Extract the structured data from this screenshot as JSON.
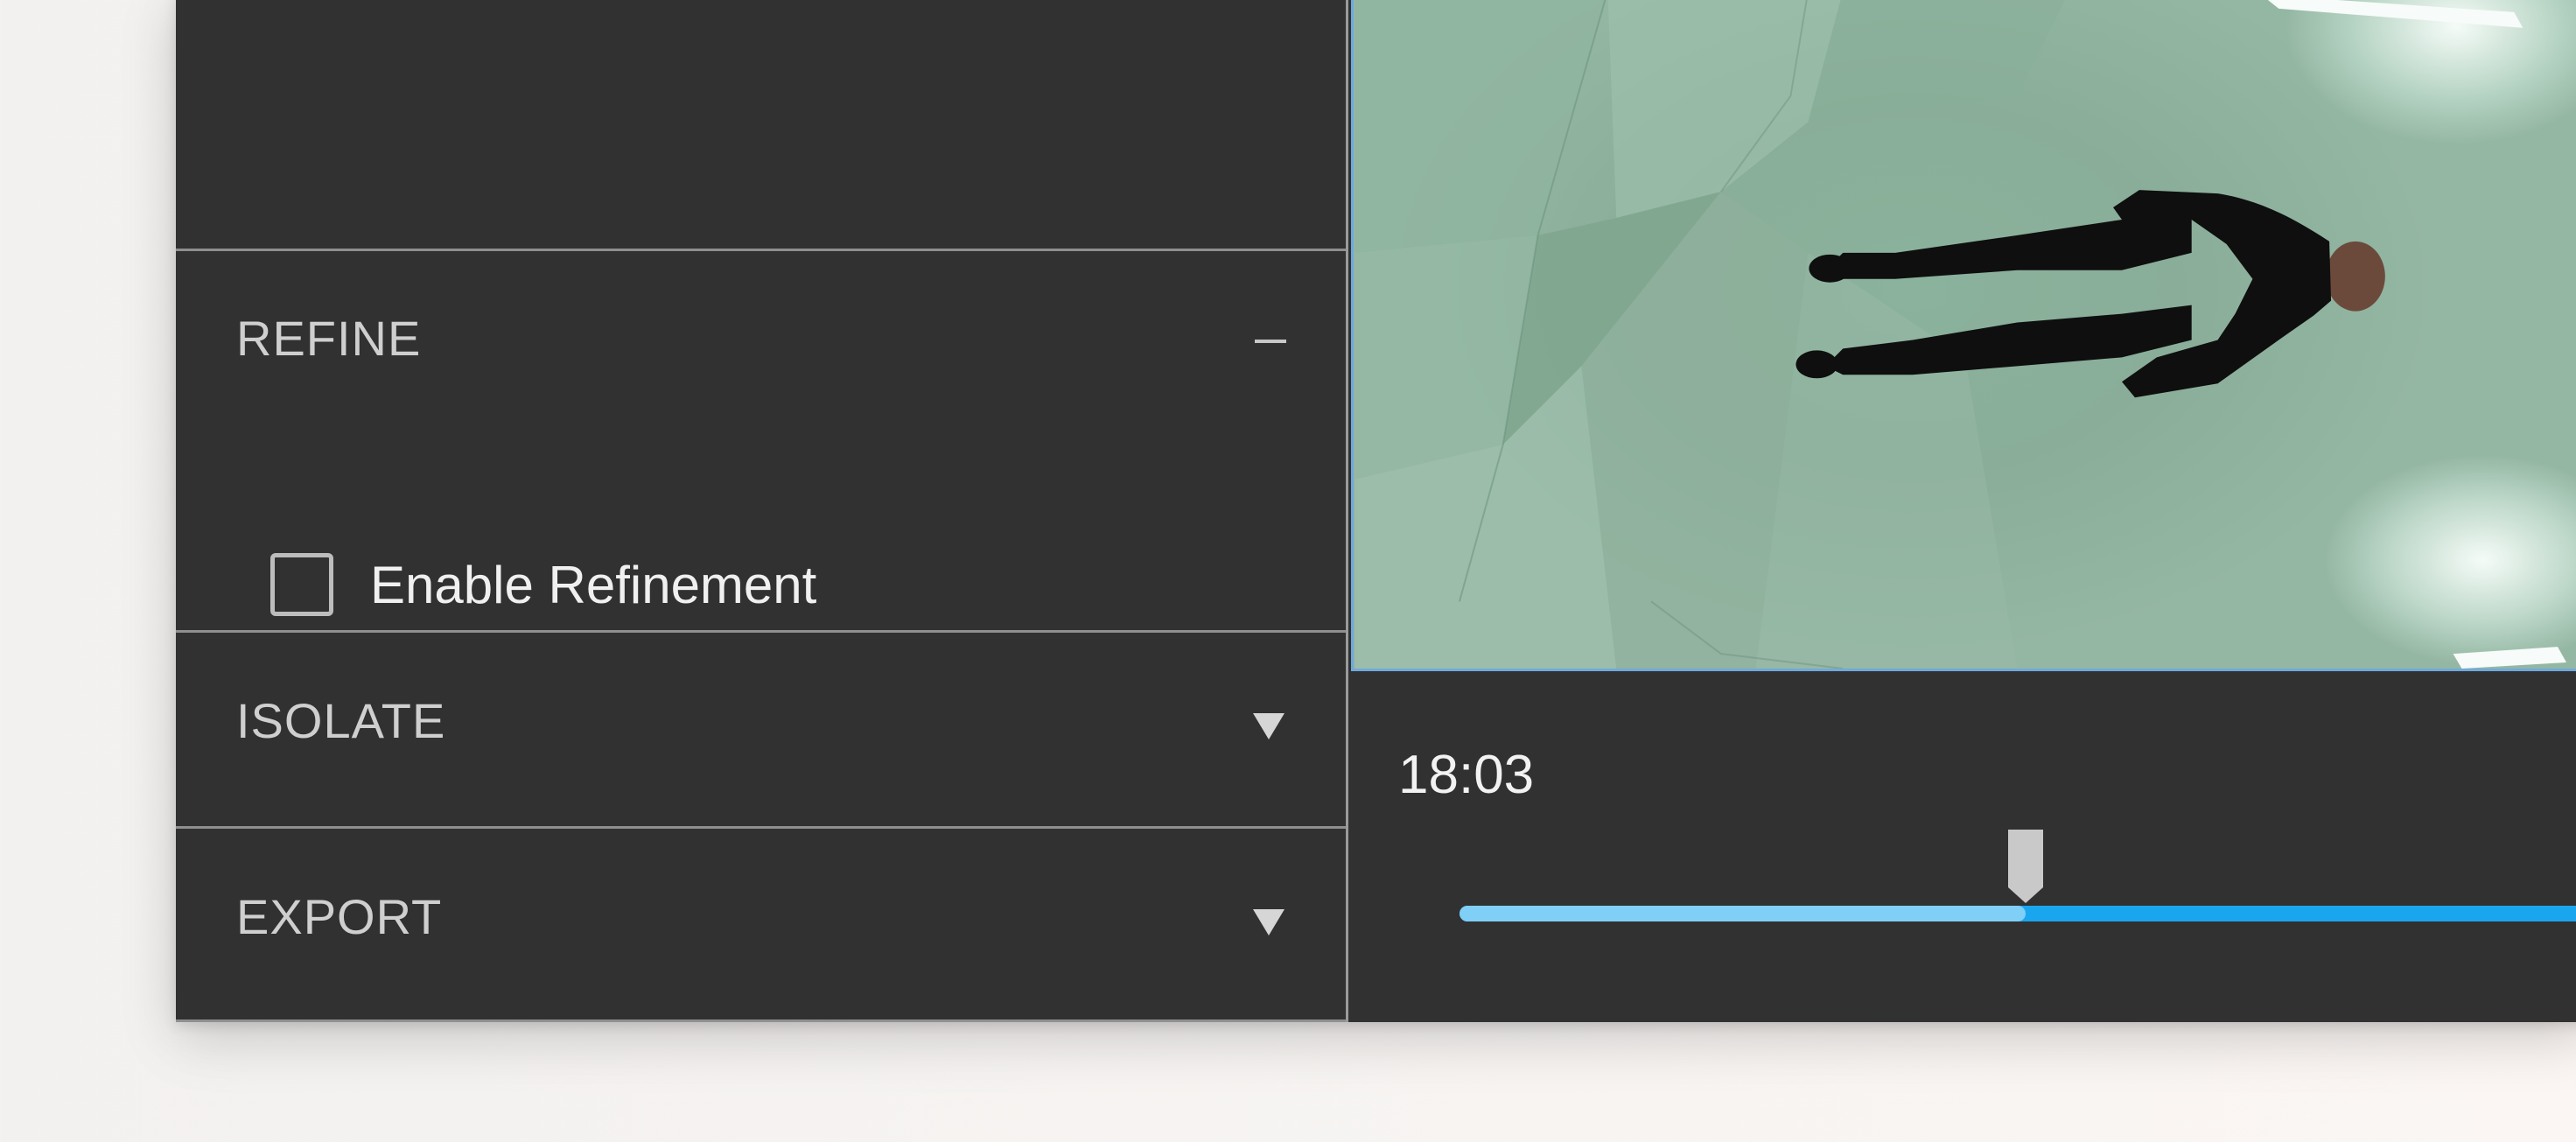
{
  "sidebar": {
    "sections": [
      {
        "id": "refine",
        "title": "REFINE",
        "expanded": true,
        "options": [
          {
            "label": "Enable Refinement",
            "checked": false
          }
        ]
      },
      {
        "id": "isolate",
        "title": "ISOLATE",
        "expanded": false
      },
      {
        "id": "export",
        "title": "EXPORT",
        "expanded": false
      }
    ]
  },
  "player": {
    "timecode": "18:03",
    "progress_fraction": 0.498
  },
  "colors": {
    "panel_bg": "#313131",
    "divider": "#8f8f8f",
    "accent": "#1aa6ee",
    "accent_played": "#7fcff7"
  },
  "icons": {
    "collapse": "minus-icon",
    "expand": "triangle-down-icon"
  }
}
